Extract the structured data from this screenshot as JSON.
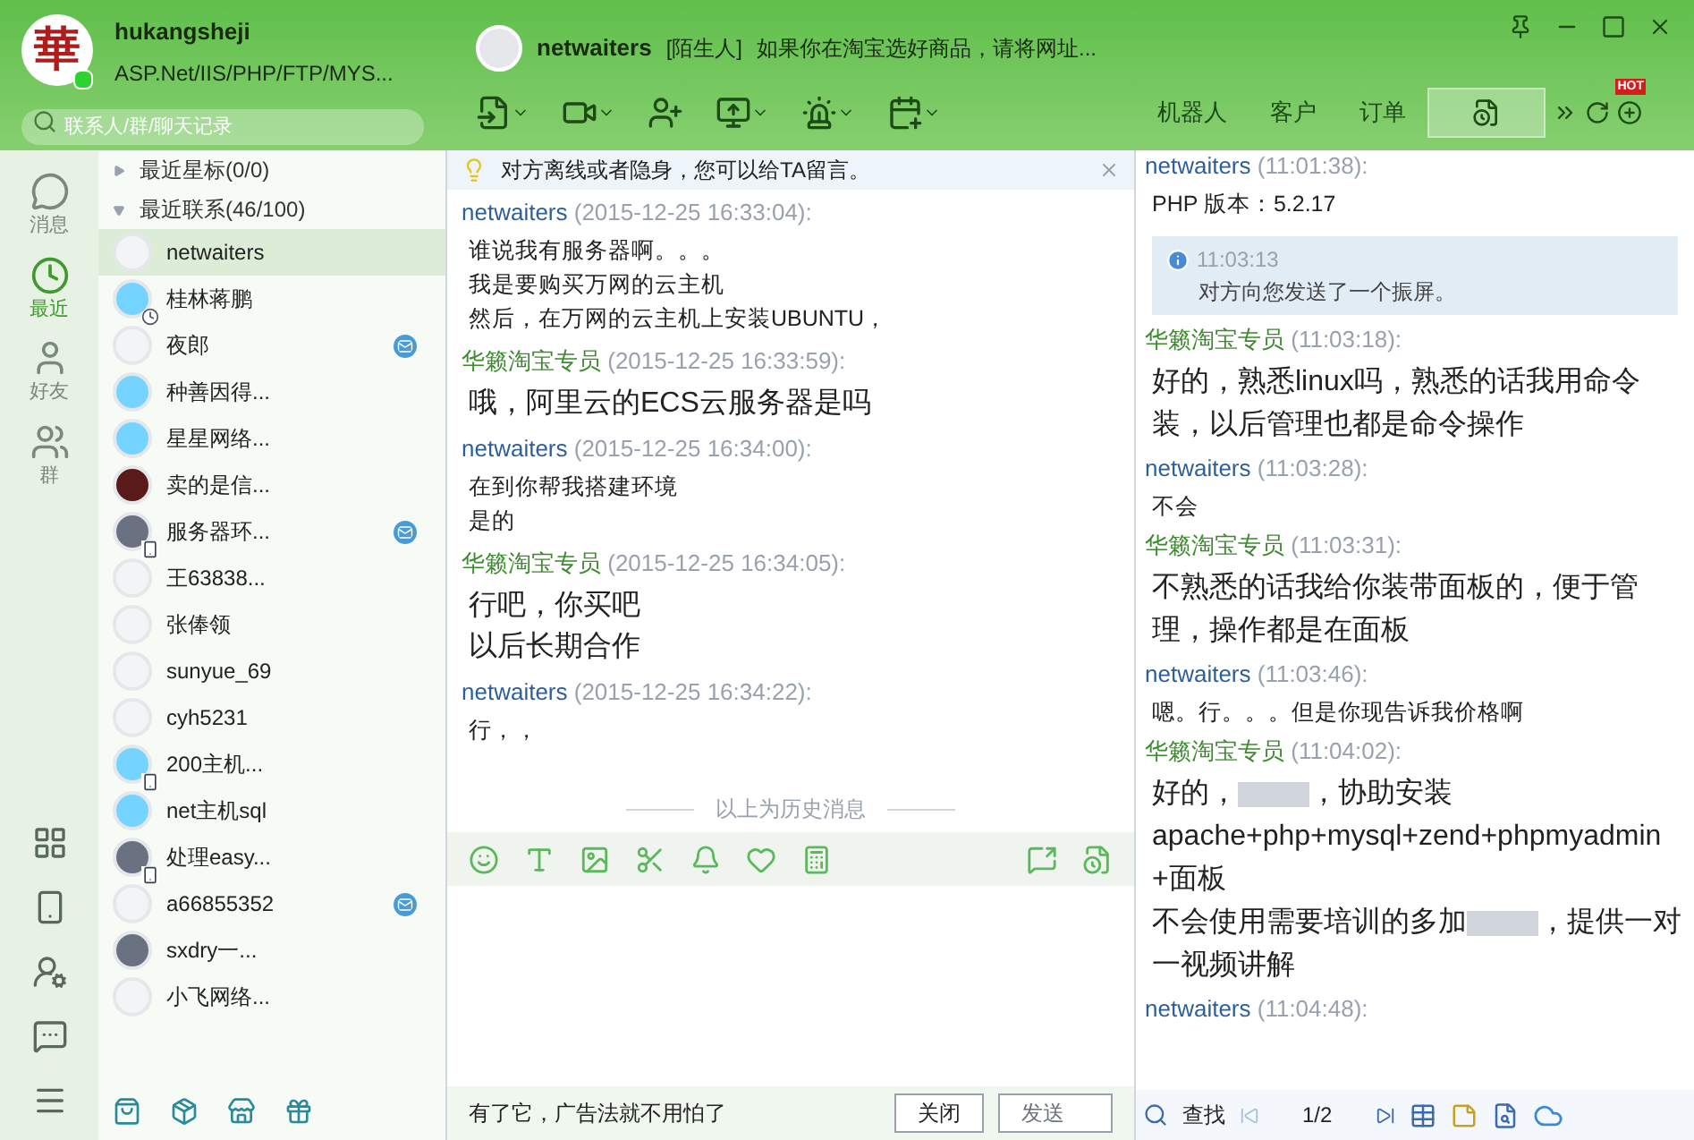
{
  "profile": {
    "name": "hukangsheji",
    "signature": "ASP.Net/IIS/PHP/FTP/MYS...",
    "avatar_char": "華",
    "online": true
  },
  "search": {
    "placeholder": "联系人/群/聊天记录"
  },
  "chat_header": {
    "name": "netwaiters",
    "tag": "[陌生人]",
    "signature": "如果你在淘宝选好商品，请将网址..."
  },
  "right_tabs": [
    {
      "label": "机器人",
      "kind": "text",
      "selected": false
    },
    {
      "label": "客户",
      "kind": "text",
      "selected": false
    },
    {
      "label": "订单",
      "kind": "text",
      "selected": false
    },
    {
      "kind": "icon",
      "selected": true
    }
  ],
  "hot_badge": "HOT",
  "nav": [
    {
      "label": "消息",
      "selected": false
    },
    {
      "label": "最近",
      "selected": true
    },
    {
      "label": "好友",
      "selected": false
    },
    {
      "label": "群",
      "selected": false
    }
  ],
  "groups": [
    {
      "label": "最近星标(0/0)",
      "expanded": false
    },
    {
      "label": "最近联系(46/100)",
      "expanded": true
    }
  ],
  "contacts": [
    {
      "name": "netwaiters",
      "kind": "plain",
      "clock_badge": false,
      "phone_badge": false,
      "mail": false,
      "selected": true
    },
    {
      "name": "桂林蒋鹏",
      "kind": "blue",
      "clock_badge": true,
      "phone_badge": false,
      "mail": false,
      "selected": false
    },
    {
      "name": "夜郎",
      "kind": "plain",
      "clock_badge": false,
      "phone_badge": false,
      "mail": true,
      "selected": false
    },
    {
      "name": "种善因得...",
      "kind": "blue",
      "clock_badge": false,
      "phone_badge": false,
      "mail": false,
      "selected": false
    },
    {
      "name": "星星网络...",
      "kind": "blue",
      "clock_badge": false,
      "phone_badge": false,
      "mail": false,
      "selected": false
    },
    {
      "name": "卖的是信...",
      "kind": "dark",
      "clock_badge": false,
      "phone_badge": false,
      "mail": false,
      "selected": false
    },
    {
      "name": "服务器环...",
      "kind": "photo",
      "clock_badge": false,
      "phone_badge": true,
      "mail": true,
      "selected": false
    },
    {
      "name": "王63838...",
      "kind": "plain",
      "clock_badge": false,
      "phone_badge": false,
      "mail": false,
      "selected": false
    },
    {
      "name": "张俸领",
      "kind": "plain",
      "clock_badge": false,
      "phone_badge": false,
      "mail": false,
      "selected": false
    },
    {
      "name": "sunyue_69",
      "kind": "plain",
      "clock_badge": false,
      "phone_badge": false,
      "mail": false,
      "selected": false
    },
    {
      "name": "cyh5231",
      "kind": "plain",
      "clock_badge": false,
      "phone_badge": false,
      "mail": false,
      "selected": false
    },
    {
      "name": "200主机...",
      "kind": "blue",
      "clock_badge": false,
      "phone_badge": true,
      "mail": false,
      "selected": false
    },
    {
      "name": "net主机sql",
      "kind": "blue",
      "clock_badge": false,
      "phone_badge": false,
      "mail": false,
      "selected": false
    },
    {
      "name": "处理easy...",
      "kind": "photo",
      "clock_badge": false,
      "phone_badge": true,
      "mail": false,
      "selected": false
    },
    {
      "name": "a66855352",
      "kind": "plain",
      "clock_badge": false,
      "phone_badge": false,
      "mail": true,
      "selected": false
    },
    {
      "name": "sxdry一...",
      "kind": "photo",
      "clock_badge": false,
      "phone_badge": false,
      "mail": false,
      "selected": false
    },
    {
      "name": "小飞网络...",
      "kind": "plain",
      "clock_badge": false,
      "phone_badge": false,
      "mail": false,
      "selected": false
    }
  ],
  "notice": "对方离线或者隐身，您可以给TA留言。",
  "history": [
    {
      "sender": "netwaiters",
      "outgoing": false,
      "time": "(2015-12-25 16:33:04):",
      "large": false,
      "lines": [
        "谁说我有服务器啊。。。",
        "我是要购买万网的云主机",
        "然后，在万网的云主机上安装UBUNTU，"
      ]
    },
    {
      "sender": "华籁淘宝专员",
      "outgoing": true,
      "time": "(2015-12-25 16:33:59):",
      "large": true,
      "lines": [
        "哦，阿里云的ECS云服务器是吗"
      ]
    },
    {
      "sender": "netwaiters",
      "outgoing": false,
      "time": "(2015-12-25 16:34:00):",
      "large": false,
      "lines": [
        "在到你帮我搭建环境",
        "是的"
      ]
    },
    {
      "sender": "华籁淘宝专员",
      "outgoing": true,
      "time": "(2015-12-25 16:34:05):",
      "large": true,
      "lines": [
        "行吧，你买吧",
        "以后长期合作"
      ]
    },
    {
      "sender": "netwaiters",
      "outgoing": false,
      "time": "(2015-12-25 16:34:22):",
      "large": false,
      "lines": [
        "行，，"
      ]
    }
  ],
  "history_divider": "以上为历史消息",
  "ad_text": "有了它，广告法就不用怕了",
  "buttons": [
    {
      "label": "关闭",
      "disabled": false
    },
    {
      "label": "发送",
      "disabled": true
    }
  ],
  "record": [
    {
      "kind": "message",
      "sender": "netwaiters",
      "outgoing": false,
      "time": "(11:01:38):",
      "large": false,
      "lines": [
        [
          {
            "text": "PHP 版本：5.2.17"
          }
        ]
      ]
    },
    {
      "kind": "system",
      "time": "11:03:13",
      "text": "对方向您发送了一个振屏。"
    },
    {
      "kind": "message",
      "sender": "华籁淘宝专员",
      "outgoing": true,
      "time": "(11:03:18):",
      "large": true,
      "lines": [
        [
          {
            "text": "好的，熟悉linux吗，熟悉的话我用命令装，以后管理也都是命令操作"
          }
        ]
      ]
    },
    {
      "kind": "message",
      "sender": "netwaiters",
      "outgoing": false,
      "time": "(11:03:28):",
      "large": false,
      "lines": [
        [
          {
            "text": "不会"
          }
        ]
      ]
    },
    {
      "kind": "message",
      "sender": "华籁淘宝专员",
      "outgoing": true,
      "time": "(11:03:31):",
      "large": true,
      "lines": [
        [
          {
            "text": "不熟悉的话我给你装带面板的，便于管理，操作都是在面板"
          }
        ]
      ]
    },
    {
      "kind": "message",
      "sender": "netwaiters",
      "outgoing": false,
      "time": "(11:03:46):",
      "large": false,
      "lines": [
        [
          {
            "text": "嗯。行。。。但是你现告诉我价格啊"
          }
        ]
      ]
    },
    {
      "kind": "message",
      "sender": "华籁淘宝专员",
      "outgoing": true,
      "time": "(11:04:02):",
      "large": true,
      "lines": [
        [
          {
            "text": "好的，"
          },
          {
            "redacted": true
          },
          {
            "text": "，协助安装"
          }
        ],
        [
          {
            "text": "apache+php+mysql+zend+phpmyadmin+面板"
          }
        ],
        [
          {
            "text": "不会使用需要培训的多加"
          },
          {
            "redacted": true
          },
          {
            "text": "，提供一对一视频讲解"
          }
        ]
      ]
    },
    {
      "kind": "message",
      "sender": "netwaiters",
      "outgoing": false,
      "time": "(11:04:48):"
    }
  ],
  "record_footer": {
    "find": "查找",
    "page": "1/2"
  }
}
